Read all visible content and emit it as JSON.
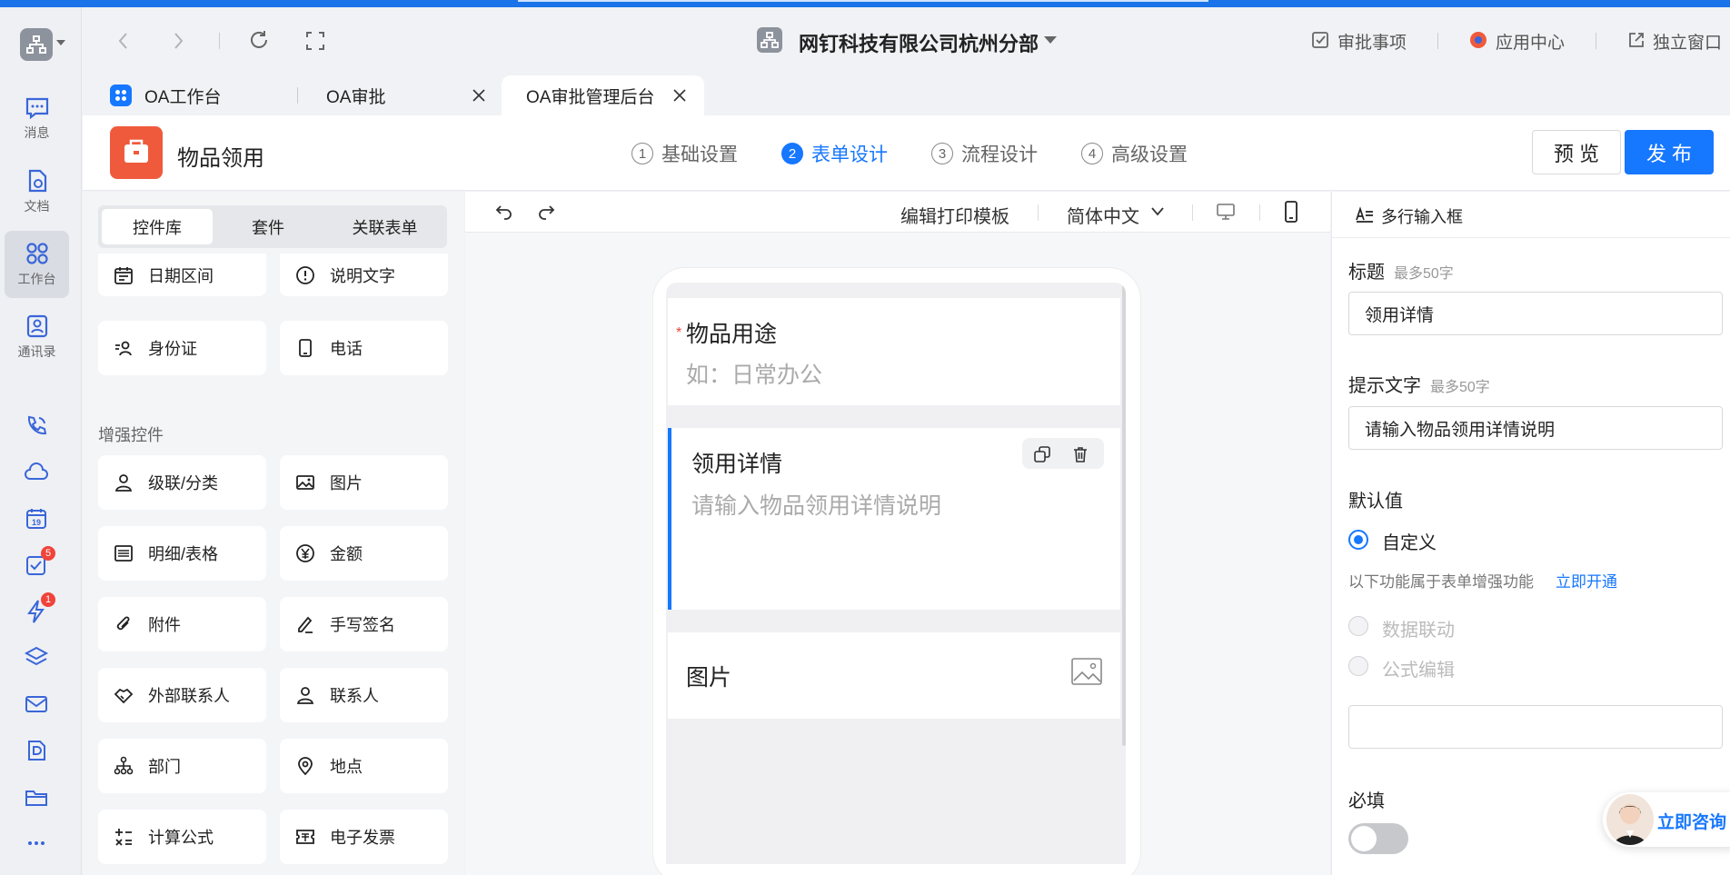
{
  "window": {
    "org_name": "网钉科技有限公司杭州分部",
    "approval_items": "审批事项",
    "app_center": "应用中心",
    "standalone_window": "独立窗口"
  },
  "rail": {
    "items": [
      {
        "label": "消息",
        "icon": "message-icon"
      },
      {
        "label": "文档",
        "icon": "document-icon"
      },
      {
        "label": "工作台",
        "icon": "workbench-icon"
      },
      {
        "label": "通讯录",
        "icon": "contacts-icon"
      }
    ],
    "todo_badge": "5",
    "ding_badge": "1"
  },
  "tabs": [
    {
      "label": "OA工作台"
    },
    {
      "label": "OA审批"
    },
    {
      "label": "OA审批管理后台"
    }
  ],
  "app": {
    "title": "物品领用",
    "steps": [
      {
        "num": "1",
        "label": "基础设置"
      },
      {
        "num": "2",
        "label": "表单设计"
      },
      {
        "num": "3",
        "label": "流程设计"
      },
      {
        "num": "4",
        "label": "高级设置"
      }
    ],
    "preview": "预 览",
    "publish": "发 布"
  },
  "left": {
    "seg": [
      "控件库",
      "套件",
      "关联表单"
    ],
    "top_widgets": [
      {
        "label": "日期区间",
        "icon": "calendar-icon"
      },
      {
        "label": "说明文字",
        "icon": "info-icon"
      },
      {
        "label": "身份证",
        "icon": "id-card-icon"
      },
      {
        "label": "电话",
        "icon": "phone-icon"
      }
    ],
    "section_title": "增强控件",
    "widgets": [
      {
        "label": "级联/分类",
        "icon": "cascade-icon"
      },
      {
        "label": "图片",
        "icon": "image-icon"
      },
      {
        "label": "明细/表格",
        "icon": "table-icon"
      },
      {
        "label": "金额",
        "icon": "money-icon"
      },
      {
        "label": "附件",
        "icon": "attachment-icon"
      },
      {
        "label": "手写签名",
        "icon": "signature-icon"
      },
      {
        "label": "外部联系人",
        "icon": "handshake-icon"
      },
      {
        "label": "联系人",
        "icon": "contact-icon"
      },
      {
        "label": "部门",
        "icon": "department-icon"
      },
      {
        "label": "地点",
        "icon": "location-icon"
      },
      {
        "label": "计算公式",
        "icon": "formula-icon"
      },
      {
        "label": "电子发票",
        "icon": "invoice-icon"
      }
    ]
  },
  "canvas": {
    "print_template": "编辑打印模板",
    "language": "简体中文",
    "fields": [
      {
        "required_mark": "*",
        "label": "物品用途",
        "placeholder": "如：日常办公"
      },
      {
        "label": "领用详情",
        "placeholder": "请输入物品领用详情说明"
      },
      {
        "label": "图片"
      }
    ]
  },
  "right": {
    "header": "多行输入框",
    "title_label": "标题",
    "title_hint": "最多50字",
    "title_value": "领用详情",
    "placeholder_label": "提示文字",
    "placeholder_hint": "最多50字",
    "placeholder_value": "请输入物品领用详情说明",
    "default_label": "默认值",
    "custom": "自定义",
    "enhance_note": "以下功能属于表单增强功能",
    "enhance_link": "立即开通",
    "data_link": "数据联动",
    "formula_edit": "公式编辑",
    "required_label": "必填",
    "consult": "立即咨询"
  },
  "colors": {
    "accent": "#1677ff",
    "app_icon_bg": "#f05a3c",
    "badge": "#f0433a"
  }
}
